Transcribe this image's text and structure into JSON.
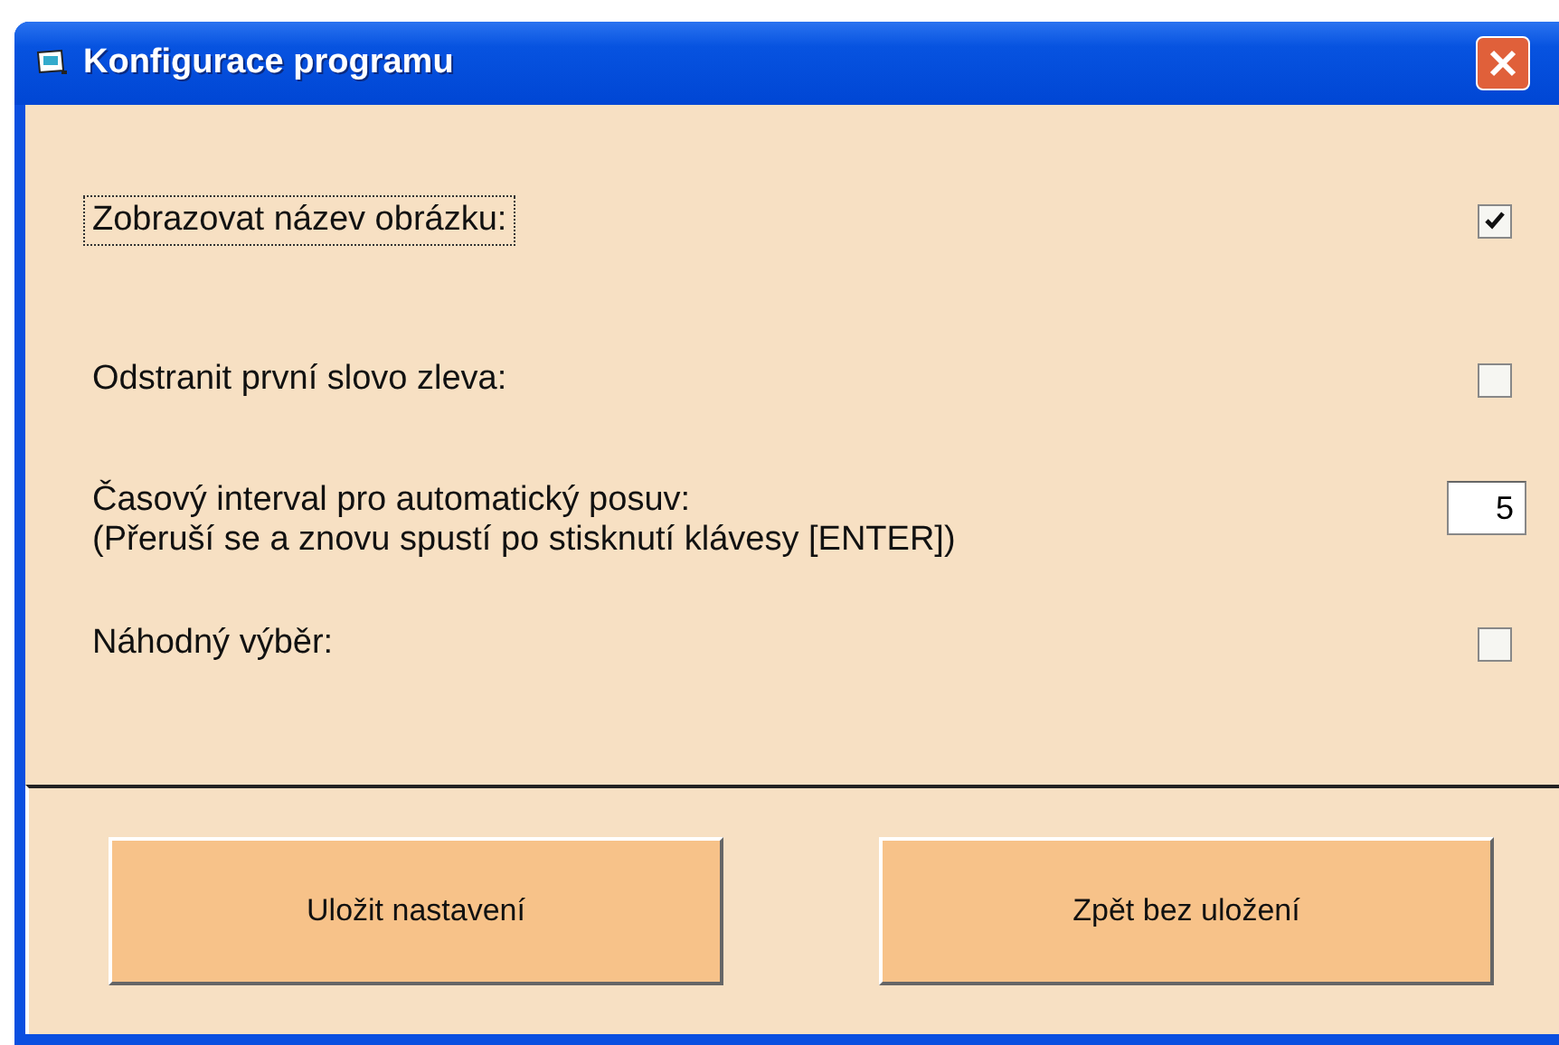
{
  "window": {
    "title": "Konfigurace programu"
  },
  "settings": [
    {
      "kind": "checkbox",
      "label": "Zobrazovat název obrázku:",
      "checked": true,
      "focused": true
    },
    {
      "kind": "checkbox",
      "label": "Odstranit první slovo zleva:",
      "checked": false,
      "focused": false
    },
    {
      "kind": "number",
      "label": "Časový interval pro automatický posuv:",
      "note": "(Přeruší se a znovu spustí po stisknutí klávesy [ENTER])",
      "value": "5"
    },
    {
      "kind": "checkbox",
      "label": "Náhodný výběr:",
      "checked": false,
      "focused": false
    }
  ],
  "buttons": [
    "Uložit nastavení",
    "Zpět bez uložení"
  ]
}
